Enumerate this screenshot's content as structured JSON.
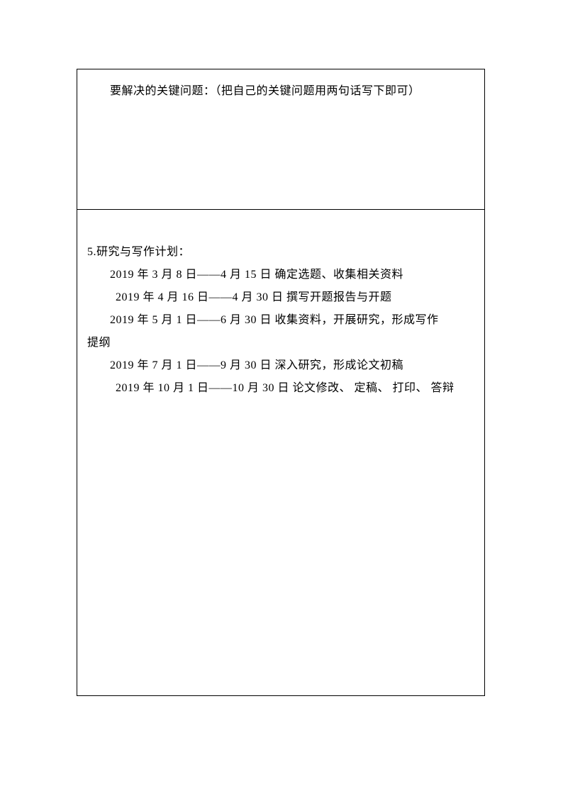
{
  "cell1": {
    "text": "要解决的关键问题：（把自己的关键问题用两句话写下即可）"
  },
  "cell2": {
    "heading": "5.研究与写作计划：",
    "lines": [
      "2019 年 3 月 8 日——4 月 15 日  确定选题、收集相关资料",
      "2019 年 4 月 16 日——4 月 30 日   撰写开题报告与开题",
      "2019 年 5 月 1 日——6 月 30 日   收集资料，开展研究，形成写作",
      "2019 年 7 月 1 日——9 月 30 日  深入研究，形成论文初稿",
      "2019 年 10 月 1 日——10 月 30 日  论文修改、 定稿、 打印、 答辩"
    ],
    "wrap": "提纲"
  }
}
